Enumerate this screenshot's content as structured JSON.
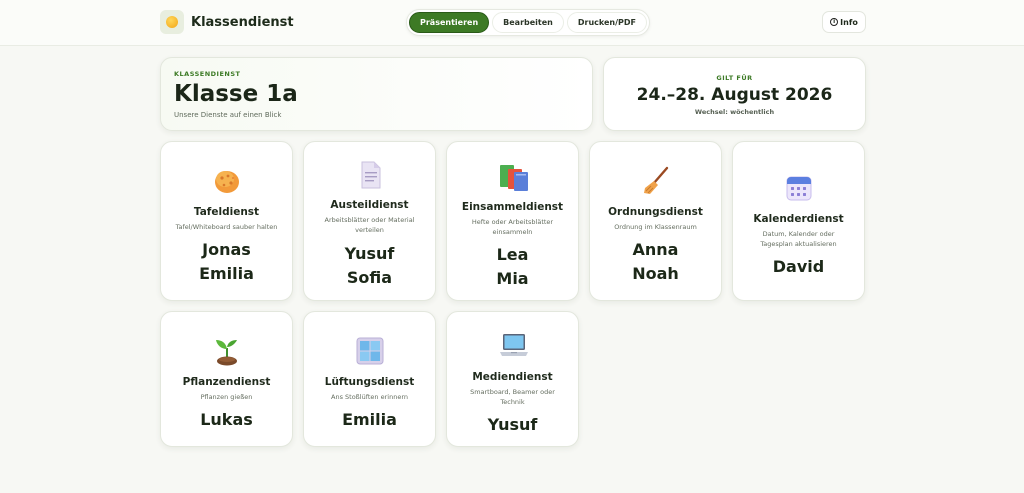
{
  "header": {
    "app_name": "Klassendienst",
    "tabs": [
      {
        "label": "Präsentieren",
        "active": true
      },
      {
        "label": "Bearbeiten",
        "active": false
      },
      {
        "label": "Drucken/PDF",
        "active": false
      }
    ],
    "info_label": "Info"
  },
  "class_info": {
    "eyebrow": "KLASSENDIENST",
    "title": "Klasse 1a",
    "subtitle": "Unsere Dienste auf einen Blick"
  },
  "validity": {
    "label": "GILT FÜR",
    "dates": "24.–28. August 2026",
    "rotation": "Wechsel: wöchentlich"
  },
  "colors": {
    "accent": "#3d7a25",
    "text": "#1f2a1c",
    "background": "#f7f8f4"
  },
  "duties": [
    {
      "title": "Tafeldienst",
      "desc": "Tafel/Whiteboard sauber halten",
      "names": [
        "Jonas",
        "Emilia"
      ],
      "icon": "sponge-icon"
    },
    {
      "title": "Austeildienst",
      "desc": "Arbeitsblätter oder Material verteilen",
      "names": [
        "Yusuf",
        "Sofia"
      ],
      "icon": "document-icon"
    },
    {
      "title": "Einsammeldienst",
      "desc": "Hefte oder Arbeitsblätter einsammeln",
      "names": [
        "Lea",
        "Mia"
      ],
      "icon": "books-icon"
    },
    {
      "title": "Ordnungsdienst",
      "desc": "Ordnung im Klassenraum",
      "names": [
        "Anna",
        "Noah"
      ],
      "icon": "broom-icon"
    },
    {
      "title": "Kalenderdienst",
      "desc": "Datum, Kalender oder Tagesplan aktualisieren",
      "names": [
        "David"
      ],
      "icon": "calendar-icon"
    },
    {
      "title": "Pflanzendienst",
      "desc": "Pflanzen gießen",
      "names": [
        "Lukas"
      ],
      "icon": "seedling-icon"
    },
    {
      "title": "Lüftungsdienst",
      "desc": "Ans Stoßlüften erinnern",
      "names": [
        "Emilia"
      ],
      "icon": "window-icon"
    },
    {
      "title": "Mediendienst",
      "desc": "Smartboard, Beamer oder Technik",
      "names": [
        "Yusuf"
      ],
      "icon": "laptop-icon"
    }
  ]
}
